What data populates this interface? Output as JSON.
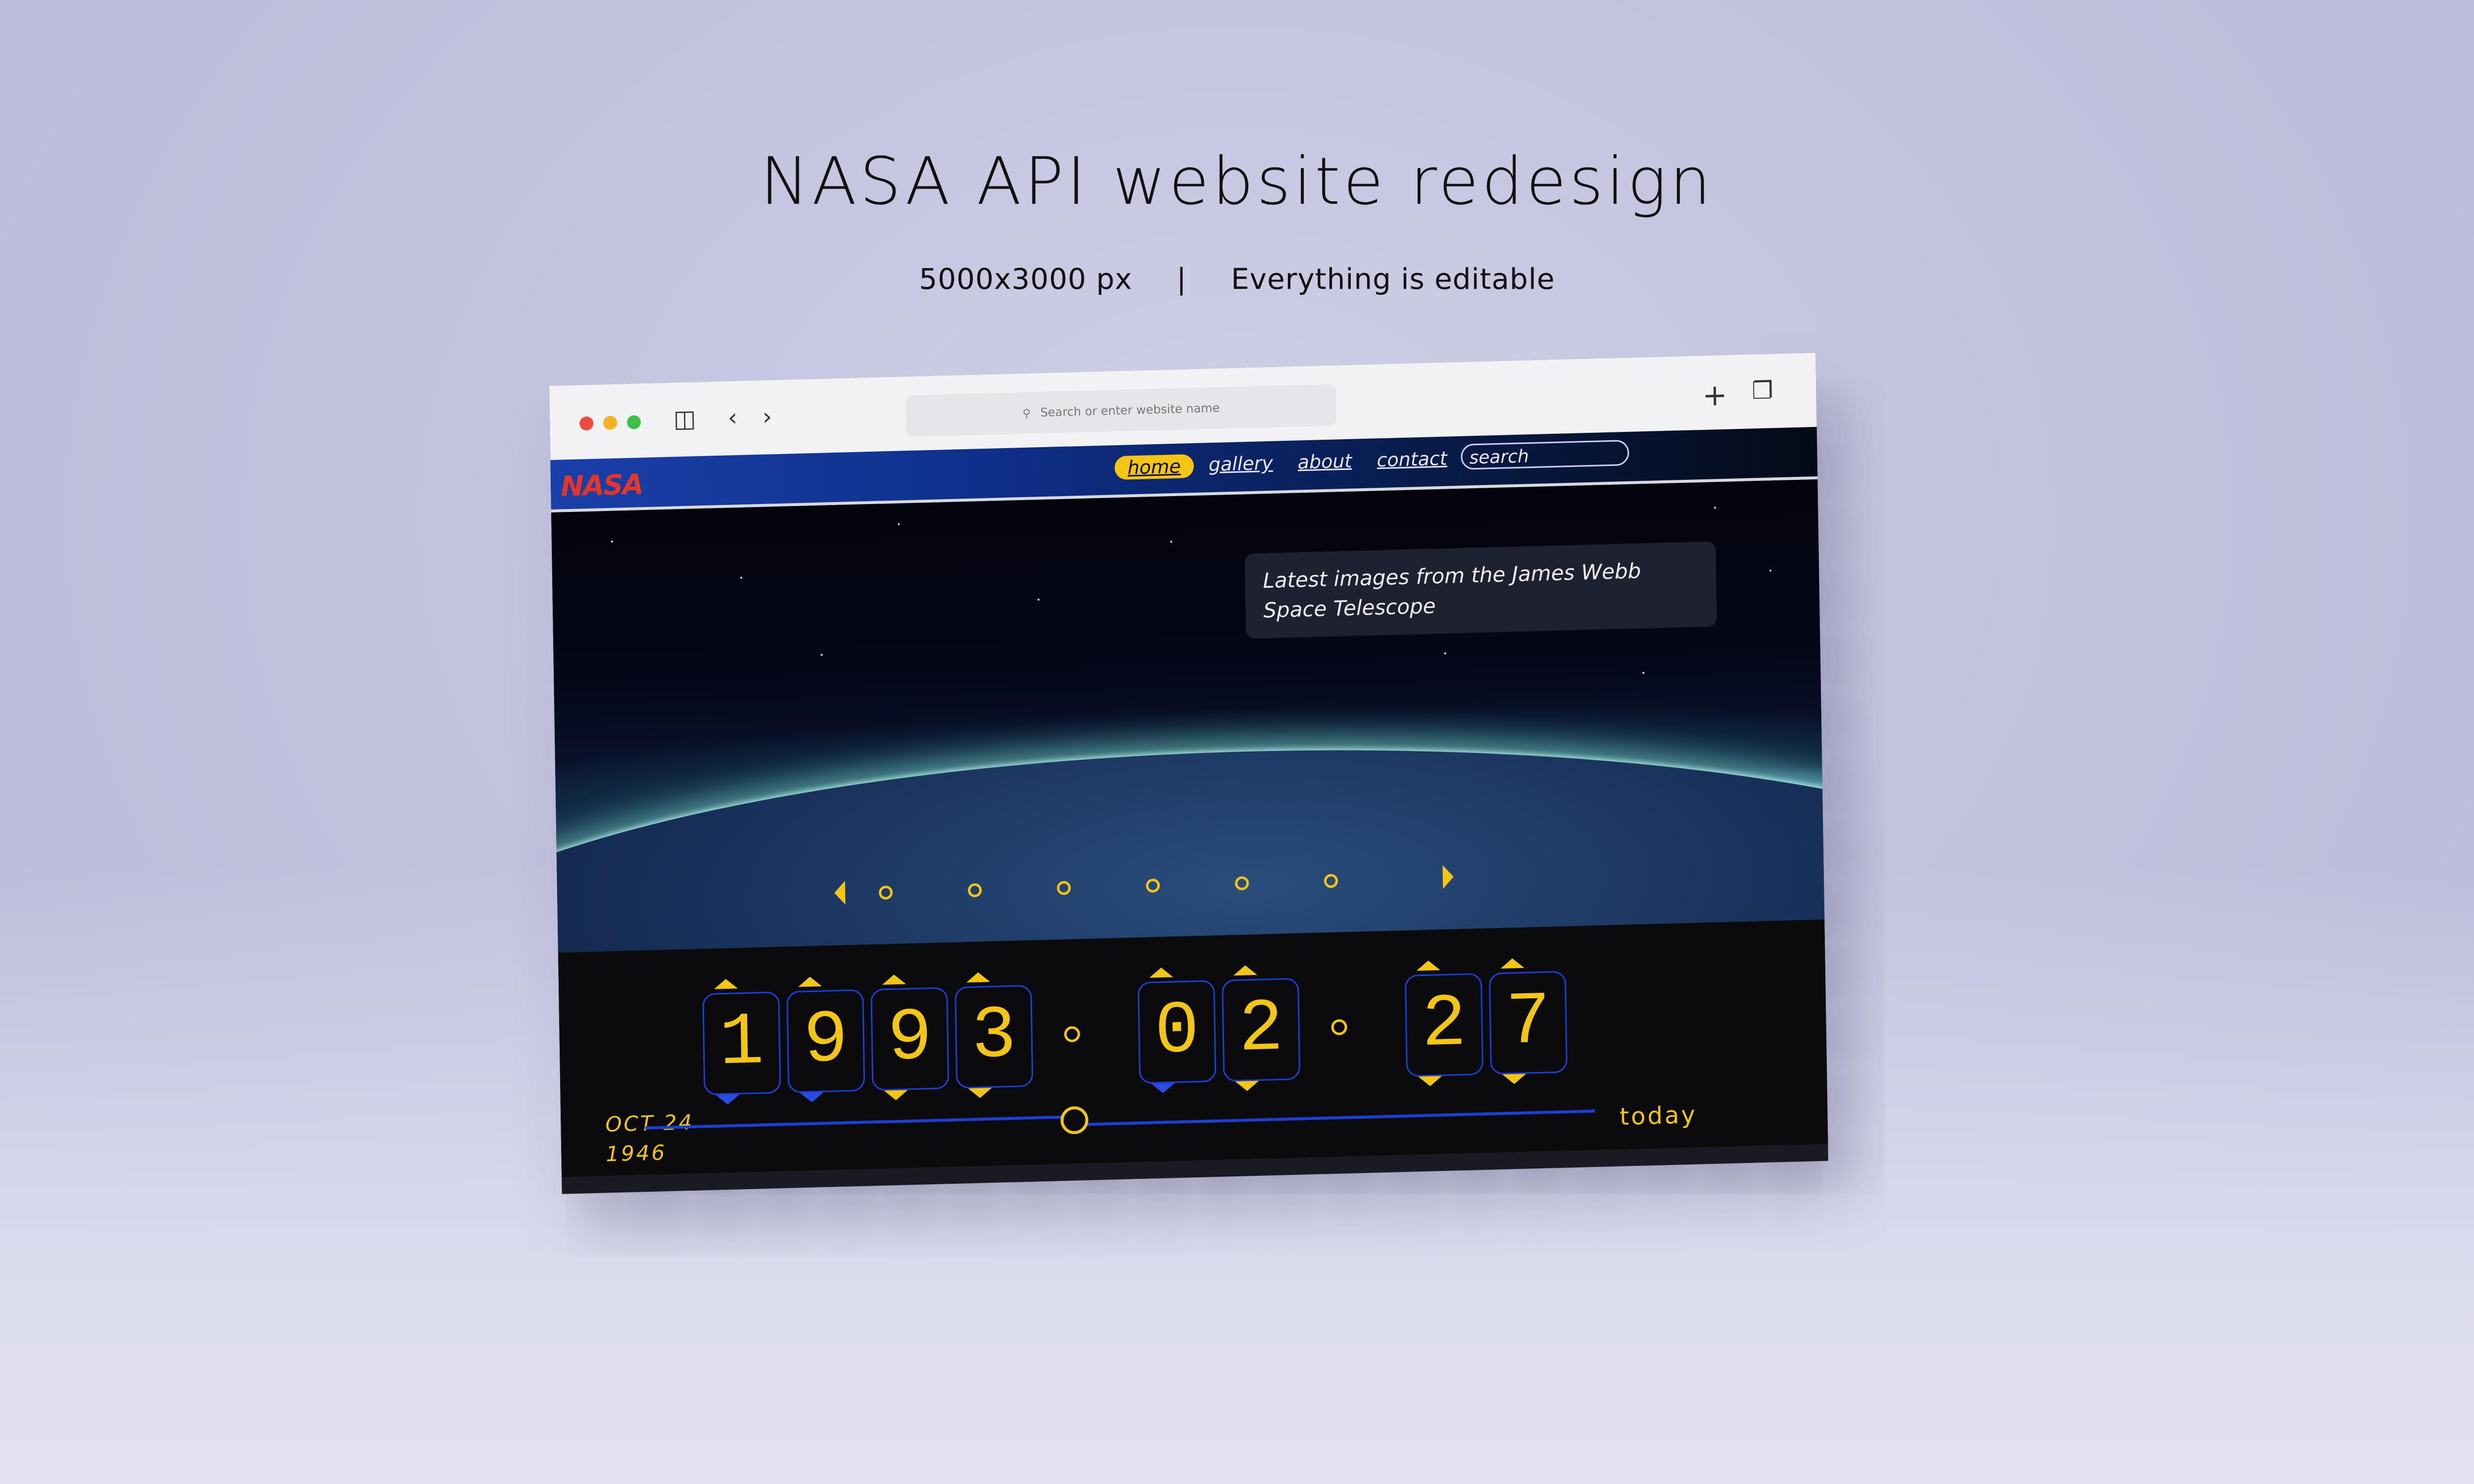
{
  "headline": {
    "title": "NASA API website redesign",
    "size_label": "5000x3000 px",
    "separator": "|",
    "editable_label": "Everything is editable"
  },
  "browser": {
    "url_placeholder": "Search or enter website name",
    "new_tab_icon": "plus-icon",
    "tabs_icon": "tabs-icon",
    "sidebar_icon": "sidebar-icon",
    "back_icon": "chevron-left-icon",
    "forward_icon": "chevron-right-icon"
  },
  "site": {
    "logo": "NASA",
    "nav": {
      "home": "home",
      "gallery": "gallery",
      "about": "about",
      "contact": "contact",
      "search_placeholder": "search"
    },
    "hero": {
      "caption": "Latest images from the James Webb Space Telescope",
      "slides_count": 6
    },
    "date": {
      "year": [
        "1",
        "9",
        "9",
        "3"
      ],
      "month": [
        "0",
        "2"
      ],
      "day": [
        "2",
        "7"
      ]
    },
    "slider": {
      "start_month_day": "OCT 24",
      "start_year": "1946",
      "end_label": "today"
    }
  },
  "colors": {
    "accent": "#f3c514",
    "outline_blue": "#1e3fd6",
    "logo_red": "#e2352b",
    "background": "#c3c3df"
  }
}
